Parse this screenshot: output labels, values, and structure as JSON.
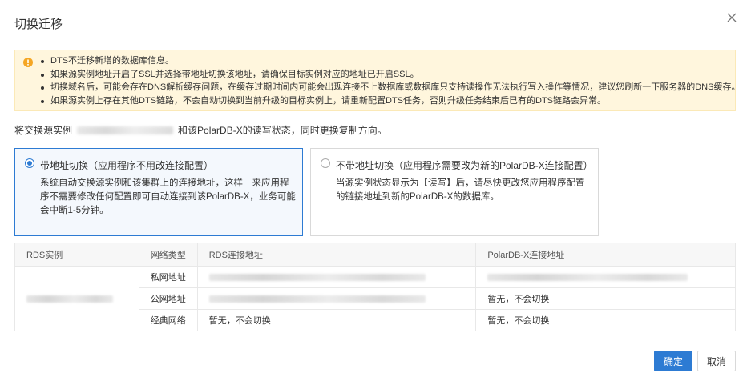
{
  "dialog": {
    "title": "切换迁移"
  },
  "notice": {
    "icon": "warning-icon",
    "items": [
      "DTS不迁移新增的数据库信息。",
      "如果源实例地址开启了SSL并选择带地址切换该地址，请确保目标实例对应的地址已开启SSL。",
      "切换域名后，可能会存在DNS解析缓存问题，在缓存过期时间内可能会出现连接不上数据库或数据库只支持读操作无法执行写入操作等情况，建议您刷新一下服务器的DNS缓存。",
      "如果源实例上存在其他DTS链路，不会自动切换到当前升级的目标实例上，请重新配置DTS任务，否则升级任务结束后已有的DTS链路会异常。"
    ]
  },
  "intro": {
    "prefix": "将交换源实例",
    "suffix": "和该PolarDB-X的读写状态，同时更换复制方向。"
  },
  "options": [
    {
      "title": "带地址切换（应用程序不用改连接配置）",
      "desc": "系统自动交换源实例和该集群上的连接地址，这样一来应用程序不需要修改任何配置即可自动连接到该PolarDB-X，业务可能会中断1-5分钟。",
      "selected": true
    },
    {
      "title": "不带地址切换（应用程序需要改为新的PolarDB-X连接配置）",
      "desc": "当源实例状态显示为【读写】后，请尽快更改您应用程序配置的链接地址到新的PolarDB-X的数据库。",
      "selected": false
    }
  ],
  "table": {
    "headers": [
      "RDS实例",
      "网络类型",
      "RDS连接地址",
      "PolarDB-X连接地址"
    ],
    "rows": [
      {
        "network": "私网地址",
        "rds_addr": "",
        "polardb_addr": ""
      },
      {
        "network": "公网地址",
        "rds_addr": "",
        "polardb_addr": "暂无，不会切换"
      },
      {
        "network": "经典网络",
        "rds_addr": "暂无，不会切换",
        "polardb_addr": "暂无，不会切换"
      }
    ]
  },
  "buttons": {
    "ok": "确定",
    "cancel": "取消"
  },
  "colors": {
    "primary": "#2d7bd3",
    "notice_bg": "#fff6dd",
    "warning": "#f5a623"
  }
}
